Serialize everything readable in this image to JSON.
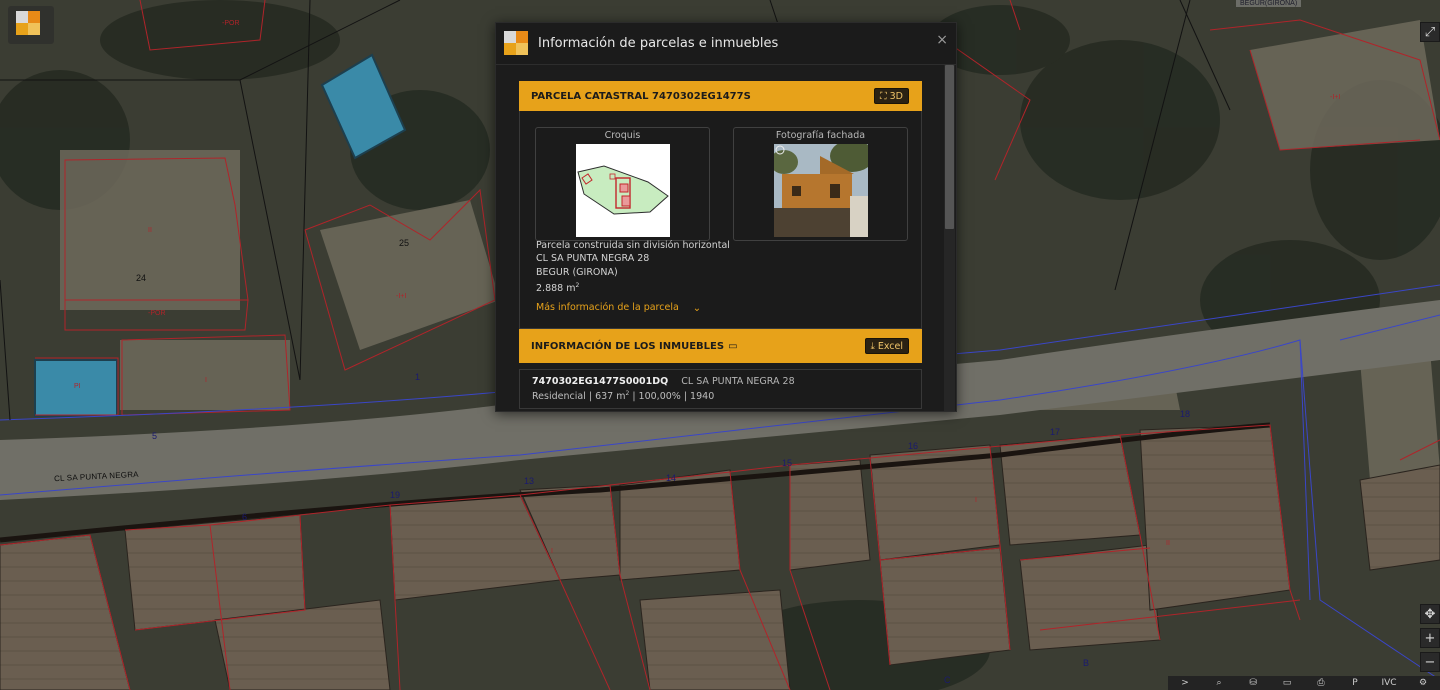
{
  "map": {
    "street_label": "CL SA PUNTA NEGRA",
    "corner_text": "BEGUR(GIRONA)",
    "plot_numbers": [
      "24",
      "25"
    ],
    "lot_letters": [
      "B",
      "C"
    ],
    "lot_numbers": [
      "1",
      "5",
      "6",
      "19",
      "13",
      "14",
      "15",
      "16",
      "17",
      "18"
    ],
    "unit_marks": [
      "-POR",
      "-I+I",
      "II",
      "I",
      "PI"
    ],
    "colors": {
      "parcel_line": "#b0242a",
      "boundary_line": "#3a46c8",
      "road": "#707069"
    }
  },
  "app": {
    "logo_icon": "catastro-logo-icon"
  },
  "dialog": {
    "title": "Información de parcelas e inmuebles",
    "close_symbol": "×",
    "parcel_section": {
      "title": "PARCELA CATASTRAL 7470302EG1477S",
      "button_3d": "3D",
      "sketch_caption": "Croquis",
      "photo_caption": "Fotografía fachada",
      "info_lines": [
        "Parcela construida sin división horizontal",
        "CL SA PUNTA NEGRA 28",
        "BEGUR (GIRONA)"
      ],
      "area_value": "2.888 m",
      "area_sup": "2",
      "more_info": "Más información de la parcela",
      "chevron": "⌄"
    },
    "units_section": {
      "title": "INFORMACIÓN DE LOS INMUEBLES",
      "excel_button": "Excel",
      "rows": [
        {
          "reference": "7470302EG1477S0001DQ",
          "address": "CL SA PUNTA NEGRA 28",
          "details_pre": "Residencial | 637 m",
          "details_sup": "2",
          "details_post": " | 100,00% | 1940"
        }
      ]
    }
  },
  "controls": {
    "fullscreen": "⤢",
    "locate": "✥",
    "zoom_in": "+",
    "zoom_out": "−",
    "toolbar": [
      ">",
      "⌕",
      "⛁",
      "▭",
      "⎙",
      "P",
      "IVC",
      "⚙"
    ]
  },
  "colors": {
    "accent": "#e7a21a",
    "dialog_bg": "#1c1c1c"
  }
}
